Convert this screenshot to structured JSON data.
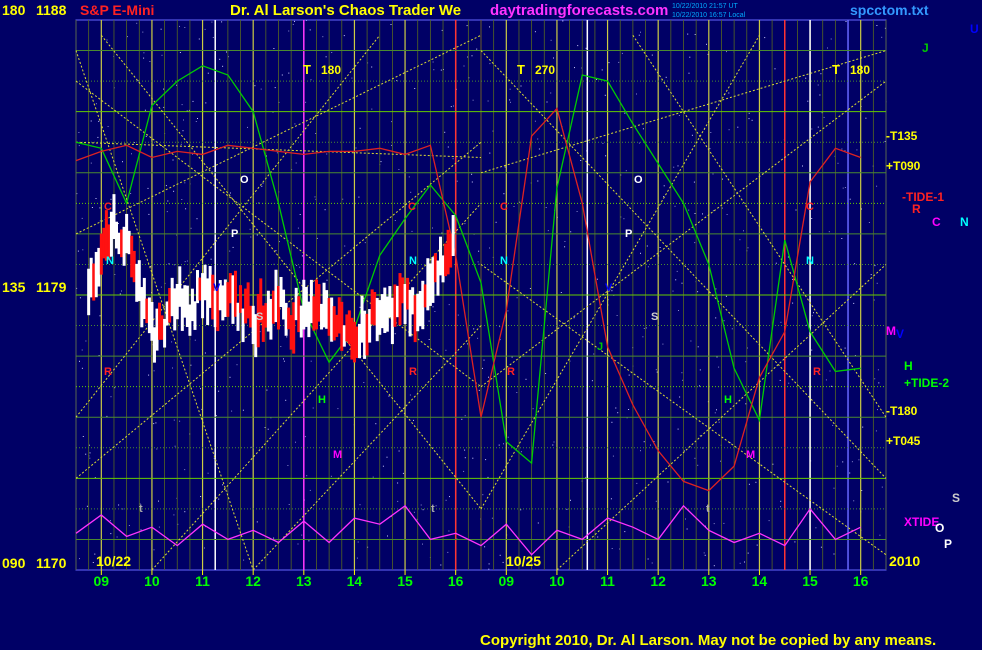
{
  "header": {
    "left_axis_top": "180",
    "price_top": "1188",
    "instrument": "S&P E-Mini",
    "title": "Dr. Al Larson's Chaos Trader We",
    "site": "daytradingforecasts.com",
    "timestamp1": "10/22/2010 21:57 UT",
    "timestamp2": "10/22/2010 16:57 Local",
    "filename": "spcctom.txt"
  },
  "left_axis": {
    "mid_angle": "135",
    "mid_price": "1179",
    "bottom_angle": "090",
    "bottom_price": "1170"
  },
  "x_axis": {
    "ticks": [
      "09",
      "10",
      "11",
      "12",
      "13",
      "14",
      "15",
      "16",
      "09",
      "10",
      "11",
      "12",
      "13",
      "14",
      "15",
      "16"
    ],
    "date1": "10/22",
    "date2": "10/25",
    "year": "2010"
  },
  "t_markers": [
    {
      "letter": "T",
      "value": "180"
    },
    {
      "letter": "T",
      "value": "270"
    },
    {
      "letter": "T",
      "value": "180"
    }
  ],
  "right_labels": [
    {
      "text": "J",
      "color": "#00cc00"
    },
    {
      "text": "U",
      "color": "#0000ff"
    },
    {
      "text": "-T135",
      "color": "#ffff00"
    },
    {
      "text": "+T090",
      "color": "#ffff00"
    },
    {
      "text": "-TIDE-1",
      "color": "#ff2222"
    },
    {
      "text": "R",
      "color": "#ff2222"
    },
    {
      "text": "C",
      "color": "#ff00ff"
    },
    {
      "text": "N",
      "color": "#00ffff"
    },
    {
      "text": "M",
      "color": "#ff00ff"
    },
    {
      "text": "V",
      "color": "#0000ff"
    },
    {
      "text": "H",
      "color": "#00ff00"
    },
    {
      "text": "+TIDE-2",
      "color": "#00ff00"
    },
    {
      "text": "-T180",
      "color": "#ffff00"
    },
    {
      "text": "+T045",
      "color": "#ffff00"
    },
    {
      "text": "S",
      "color": "#cccccc"
    },
    {
      "text": "XTIDE",
      "color": "#ff00ff"
    },
    {
      "text": "O",
      "color": "#ffffff"
    },
    {
      "text": "P",
      "color": "#ffffff"
    }
  ],
  "planet_markers": [
    {
      "text": "C",
      "color": "#ff2222"
    },
    {
      "text": "O",
      "color": "#ffffff"
    },
    {
      "text": "P",
      "color": "#ffffff"
    },
    {
      "text": "N",
      "color": "#00ffff"
    },
    {
      "text": "S",
      "color": "#cccccc"
    },
    {
      "text": "H",
      "color": "#00ff00"
    },
    {
      "text": "M",
      "color": "#ff00ff"
    },
    {
      "text": "R",
      "color": "#ff2222"
    },
    {
      "text": "J",
      "color": "#00cc00"
    },
    {
      "text": "V",
      "color": "#0000ff"
    },
    {
      "text": "t",
      "color": "#aaaaaa"
    }
  ],
  "copyright": "Copyright 2010, Dr. Al Larson. May not be copied by any means.",
  "chart_data": {
    "type": "line",
    "title": "S&P E-Mini",
    "y_range": [
      1170,
      1188
    ],
    "angle_range": [
      90,
      180
    ],
    "x_labels": [
      "09",
      "10",
      "11",
      "12",
      "13",
      "14",
      "15",
      "16",
      "09",
      "10",
      "11",
      "12",
      "13",
      "14",
      "15",
      "16"
    ],
    "sessions": [
      "10/22",
      "10/25"
    ],
    "series": [
      {
        "name": "price bars",
        "color": "#ffffff",
        "x": [
          8.75,
          9.0,
          9.25,
          9.5,
          9.75,
          10.0,
          10.25,
          10.5,
          10.75,
          11.0,
          11.25,
          11.5,
          11.75,
          12.0,
          12.25,
          12.5,
          12.75,
          13.0,
          13.25,
          13.5,
          13.75,
          14.0,
          14.25,
          14.5,
          14.75,
          15.0,
          15.25,
          15.5,
          15.75,
          16.0
        ],
        "values": [
          1179.0,
          1180.3,
          1181.4,
          1180.6,
          1179.4,
          1177.6,
          1178.2,
          1178.8,
          1178.5,
          1179.3,
          1178.7,
          1179.0,
          1178.6,
          1178.2,
          1178.4,
          1178.9,
          1178.3,
          1178.5,
          1178.6,
          1178.4,
          1177.9,
          1177.6,
          1178.1,
          1178.4,
          1178.6,
          1178.9,
          1178.3,
          1179.1,
          1180.2,
          1181.2
        ]
      },
      {
        "name": "+TIDE-2",
        "color": "#00cc00",
        "x": [
          8.5,
          9.0,
          9.5,
          10.0,
          10.5,
          11.0,
          11.5,
          12.0,
          12.5,
          13.0,
          13.5,
          14.0,
          14.5,
          15.0,
          15.5,
          16.0,
          16.5,
          17.0,
          17.5,
          18.0,
          18.5,
          19.0,
          19.5,
          20.0,
          20.5,
          21.0,
          21.5,
          22.0,
          22.5,
          23.0,
          23.5,
          24.0
        ],
        "values": [
          1184.0,
          1183.8,
          1182.0,
          1185.2,
          1186.0,
          1186.5,
          1186.2,
          1185.0,
          1182.0,
          1178.5,
          1176.8,
          1177.9,
          1180.3,
          1181.5,
          1182.6,
          1181.6,
          1179.4,
          1174.2,
          1173.5,
          1182.5,
          1186.2,
          1186.0,
          1184.6,
          1183.3,
          1182.0,
          1180.0,
          1176.6,
          1174.9,
          1180.8,
          1177.8,
          1176.5,
          1176.6
        ]
      },
      {
        "name": "-TIDE-1",
        "color": "#dd2222",
        "x": [
          8.5,
          9.0,
          9.5,
          10.0,
          10.5,
          11.0,
          11.5,
          12.0,
          12.5,
          13.0,
          13.5,
          14.0,
          14.5,
          15.0,
          15.5,
          16.0,
          16.5,
          17.0,
          17.5,
          18.0,
          18.5,
          19.0,
          19.5,
          20.0,
          20.5,
          21.0,
          21.5,
          22.0,
          22.5,
          23.0,
          23.5,
          24.0
        ],
        "values": [
          1183.4,
          1183.7,
          1183.9,
          1183.5,
          1183.7,
          1183.6,
          1183.9,
          1183.8,
          1183.7,
          1183.6,
          1183.7,
          1183.7,
          1183.8,
          1183.6,
          1183.9,
          1180.3,
          1175.0,
          1178.5,
          1184.2,
          1185.1,
          1182.0,
          1177.3,
          1175.4,
          1173.9,
          1172.9,
          1172.6,
          1173.4,
          1176.3,
          1177.8,
          1182.7,
          1183.8,
          1183.5
        ]
      },
      {
        "name": "XTIDE",
        "color": "#ff33ff",
        "x": [
          8.5,
          9.0,
          9.5,
          10.0,
          10.5,
          11.0,
          11.5,
          12.0,
          12.5,
          13.0,
          13.5,
          14.0,
          14.5,
          15.0,
          15.5,
          16.0,
          16.5,
          17.0,
          17.5,
          18.0,
          18.5,
          19.0,
          19.5,
          20.0,
          20.5,
          21.0,
          21.5,
          22.0,
          22.5,
          23.0,
          23.5,
          24.0
        ],
        "values": [
          1171.2,
          1171.8,
          1171.1,
          1171.4,
          1170.8,
          1171.5,
          1171.0,
          1171.3,
          1170.9,
          1171.6,
          1170.9,
          1171.7,
          1171.5,
          1172.1,
          1171.0,
          1171.2,
          1170.8,
          1171.5,
          1170.5,
          1171.3,
          1171.0,
          1171.7,
          1171.4,
          1171.0,
          1172.1,
          1171.3,
          1170.9,
          1171.2,
          1170.8,
          1172.0,
          1171.0,
          1171.4
        ]
      }
    ],
    "time_markers": [
      {
        "label": "T",
        "value": 180,
        "x": 13.0
      },
      {
        "label": "T",
        "value": 270,
        "x": 16.6
      },
      {
        "label": "T",
        "value": 180,
        "x": 23.0
      }
    ]
  }
}
